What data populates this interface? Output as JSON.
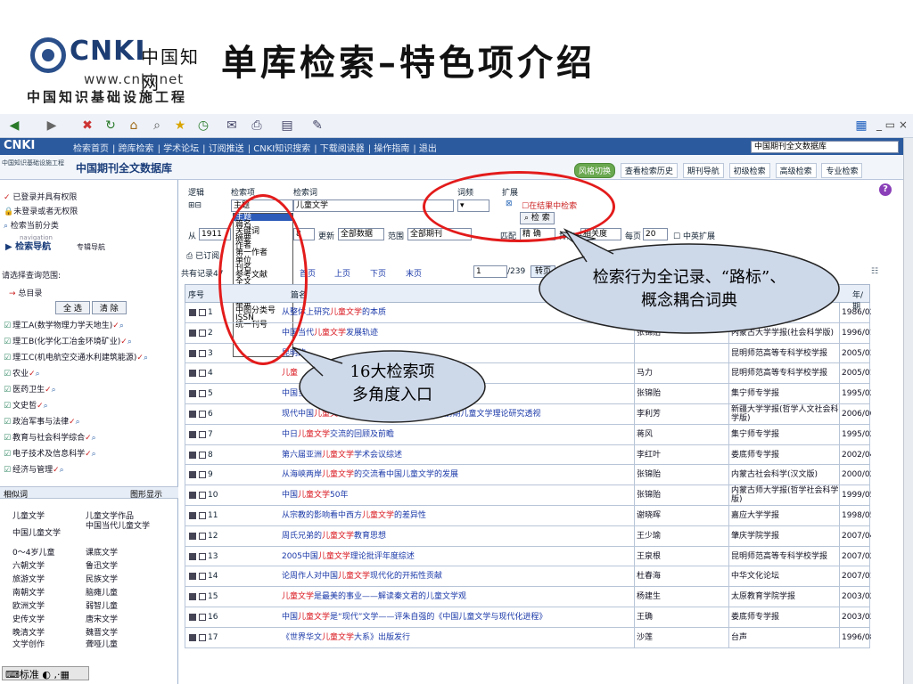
{
  "slide": {
    "logo_name": "CNKI",
    "logo_cn": "中国知网",
    "logo_url": "www.cnki.net",
    "logo_tagline": "中国知识基础设施工程",
    "title": "单库检索–特色项介绍"
  },
  "browser": {
    "window_controls": "_ ▭ ×"
  },
  "nav": {
    "links": [
      "检索首页",
      "跨库检索",
      "学术论坛",
      "订阅推送",
      "CNKI知识搜索",
      "下载阅读器",
      "操作指南",
      "退出"
    ],
    "db_select": "中国期刊全文数据库"
  },
  "sub_header": {
    "small_logo": "中国知识基础设施工程",
    "db_title": "中国期刊全文数据库",
    "tabs": [
      "风格切换",
      "查看检索历史",
      "期刊导航",
      "初级检索",
      "高级检索",
      "专业检索"
    ]
  },
  "left": {
    "login_lines": [
      "已登录并具有权限",
      "未登录或者无权限",
      "检索当前分类"
    ],
    "nav_title": "检索导航",
    "nav_sub": "专辑导航",
    "nav_small": "navigation",
    "scope_label": "请选择查询范围:",
    "total_label": "总目录",
    "select_all": "全 选",
    "clear": "清 除",
    "categories": [
      "理工A(数学物理力学天地生)",
      "理工B(化学化工冶金环境矿业)",
      "理工C(机电航空交通水利建筑能源)",
      "农业",
      "医药卫生",
      "文史哲",
      "政治军事与法律",
      "教育与社会科学综合",
      "电子技术及信息科学",
      "经济与管理"
    ],
    "similar_label": "相似词",
    "graph_label": "图形显示",
    "similar_words": [
      [
        "儿童文学",
        "儿童文学作品"
      ],
      [
        "中国儿童文学",
        "中国当代儿童文学"
      ],
      [
        "0～4岁儿童",
        "课底文学"
      ],
      [
        "六朝文学",
        "鲁迅文学"
      ],
      [
        "旅游文学",
        "民族文学"
      ],
      [
        "南朝文学",
        "脑瘫儿童"
      ],
      [
        "欧洲文学",
        "弱智儿童"
      ],
      [
        "史传文学",
        "唐宋文学"
      ],
      [
        "晚清文学",
        "魏晋文学"
      ],
      [
        "文学创作",
        "聋哑儿童"
      ]
    ],
    "status": "标准"
  },
  "search": {
    "logic_label": "逻辑",
    "field_label": "检索项",
    "term_label": "检索词",
    "freq_label": "词频",
    "ext_label": "扩展",
    "field_value": "主题",
    "term_value": "儿童文学",
    "in_result": "在结果中检索",
    "search_btn": "检 索",
    "from_label": "从",
    "from_value": "1911",
    "to_value": "8",
    "update_label": "更新",
    "update_value": "全部数据",
    "range_label": "范围",
    "range_value": "全部期刊",
    "match_label": "匹配",
    "match_value": "精 确",
    "sort_label": "排序",
    "sort_value": "相关度",
    "perpage_label": "每页",
    "perpage_value": "20",
    "cn_en": "中英扩展",
    "subscribed": "已订阅",
    "count_prefix": "共有记录47",
    "pager": [
      "首页",
      "上页",
      "下页",
      "末页"
    ],
    "page_input": "1",
    "page_total": "/239",
    "goto": "转页",
    "dropdown_options": [
      "主题",
      "篇名",
      "关键词",
      "摘要",
      "作者",
      "第一作者",
      "单位",
      "刊名",
      "参考文献",
      "全文",
      "年",
      "期",
      "基金",
      "中图分类号",
      "ISSN",
      "统一刊号"
    ]
  },
  "table": {
    "headers": [
      "序号",
      "篇名",
      "作者",
      "刊名",
      "年/期"
    ],
    "rows": [
      {
        "n": "1",
        "pre": "从整体上研究",
        "hl": "儿童文学",
        "post": "的本质",
        "author": "",
        "journal": "",
        "period": "1986/02"
      },
      {
        "n": "2",
        "pre": "中国当代",
        "hl": "儿童文学",
        "post": "发展轨迹",
        "author": "张锦贻",
        "journal": "内蒙古大学学报(社会科学版)",
        "period": "1996/01"
      },
      {
        "n": "3",
        "pre": "昆明的",
        "hl": "",
        "post": "",
        "author": "",
        "journal": "昆明师范高等专科学校学报",
        "period": "2005/03"
      },
      {
        "n": "4",
        "pre": "",
        "hl": "儿童",
        "post": "",
        "author": "马力",
        "journal": "昆明师范高等专科学校学报",
        "period": "2005/01"
      },
      {
        "n": "5",
        "pre": "中国当代",
        "hl": "儿童文学",
        "post": "",
        "author": "张锦贻",
        "journal": "集宁师专学报",
        "period": "1995/02"
      },
      {
        "n": "6",
        "pre": "现代中国",
        "hl": "儿童文学",
        "post": "的三大来源——中国20世纪前期儿童文学理论研究透视",
        "author": "李利芳",
        "journal": "新疆大学学报(哲学人文社会科学版)",
        "period": "2006/06"
      },
      {
        "n": "7",
        "pre": "中日",
        "hl": "儿童文学",
        "post": "交流的回顾及前瞻",
        "author": "蒋风",
        "journal": "集宁师专学报",
        "period": "1995/02"
      },
      {
        "n": "8",
        "pre": "第六届亚洲",
        "hl": "儿童文学",
        "post": "学术会议综述",
        "author": "李红叶",
        "journal": "娄底师专学报",
        "period": "2002/04"
      },
      {
        "n": "9",
        "pre": "从海峡两岸",
        "hl": "儿童文学",
        "post": "的交流看中国儿童文学的发展",
        "author": "张锦贻",
        "journal": "内蒙古社会科学(汉文版)",
        "period": "2000/02"
      },
      {
        "n": "10",
        "pre": "中国",
        "hl": "儿童文学",
        "post": "50年",
        "author": "张锦贻",
        "journal": "内蒙古师大学报(哲学社会科学版)",
        "period": "1999/05"
      },
      {
        "n": "11",
        "pre": "从宗教的影响看中西方",
        "hl": "儿童文学",
        "post": "的差异性",
        "author": "谢晓晖",
        "journal": "嘉应大学学报",
        "period": "1998/05"
      },
      {
        "n": "12",
        "pre": "周氏兄弟的",
        "hl": "儿童文学",
        "post": "教育思想",
        "author": "王少瑜",
        "journal": "肇庆学院学报",
        "period": "2007/04"
      },
      {
        "n": "13",
        "pre": "2005中国",
        "hl": "儿童文学",
        "post": "理论批评年度综述",
        "author": "王泉根",
        "journal": "昆明师范高等专科学校学报",
        "period": "2007/02"
      },
      {
        "n": "14",
        "pre": "论周作人对中国",
        "hl": "儿童文学",
        "post": "现代化的开拓性贡献",
        "author": "杜春海",
        "journal": "中华文化论坛",
        "period": "2007/01"
      },
      {
        "n": "15",
        "pre": "",
        "hl": "儿童文学",
        "post": "是最美的事业——解读秦文君的儿童文学观",
        "author": "杨建生",
        "journal": "太原教育学院学报",
        "period": "2003/02"
      },
      {
        "n": "16",
        "pre": "中国",
        "hl": "儿童文学",
        "post": "是“现代”文学——评朱自强的《中国儿童文学与现代化进程》",
        "author": "王确",
        "journal": "娄底师专学报",
        "period": "2003/03"
      },
      {
        "n": "17",
        "pre": "《世界华文",
        "hl": "儿童文学",
        "post": "大系》出版发行",
        "author": "沙莲",
        "journal": "台声",
        "period": "1996/08"
      }
    ]
  },
  "callouts": {
    "a_line1": "检索行为全记录、“路标”、",
    "a_line2": "概念耦合词典",
    "b_line1": "16大检索项",
    "b_line2": "多角度入口"
  },
  "colors": {
    "accent": "#2b5a9e",
    "highlight": "#d8121a",
    "annotation": "#e31b1b"
  }
}
